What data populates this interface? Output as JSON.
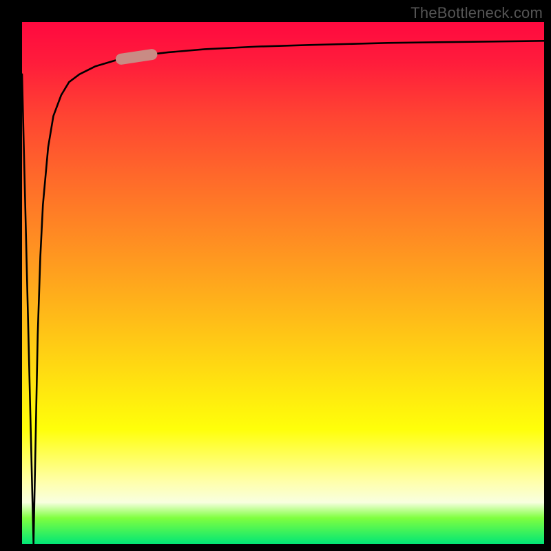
{
  "watermark": "TheBottleneck.com",
  "chart_data": {
    "type": "line",
    "title": "",
    "xlabel": "",
    "ylabel": "",
    "xlim": [
      0,
      100
    ],
    "ylim": [
      0,
      100
    ],
    "grid": false,
    "legend": null,
    "series": [
      {
        "name": "curve",
        "x": [
          0,
          2.2,
          2.6,
          3.0,
          3.5,
          4.0,
          5.0,
          6.0,
          7.5,
          9.0,
          11,
          14,
          18,
          22,
          28,
          35,
          45,
          55,
          70,
          85,
          100
        ],
        "values": [
          90,
          0,
          20,
          40,
          55,
          65,
          76,
          82,
          86,
          88.5,
          90,
          91.5,
          92.7,
          93.5,
          94.2,
          94.8,
          95.3,
          95.6,
          96.0,
          96.2,
          96.4
        ]
      }
    ],
    "highlight_segment": {
      "x_start": 18,
      "x_end": 26,
      "y_start": 92.7,
      "y_end": 93.9
    }
  },
  "colors": {
    "curve": "#000000",
    "highlight": "#c98b84",
    "bg_top": "#ff093f",
    "bg_bottom": "#00e676",
    "frame": "#000000",
    "watermark": "#555555"
  }
}
